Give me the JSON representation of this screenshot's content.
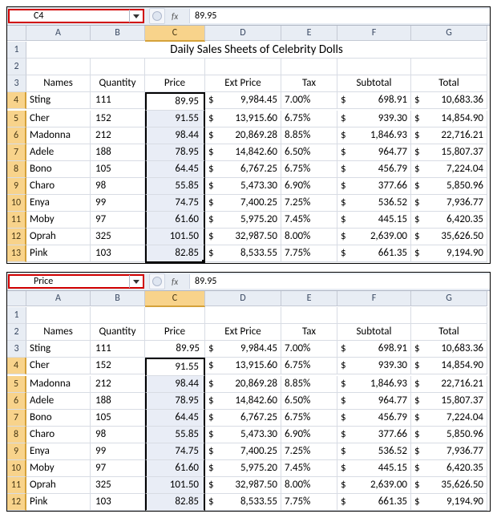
{
  "sheets": [
    {
      "nameBox": "C4",
      "formula": "89.95",
      "showTitle": true
    },
    {
      "nameBox": "Price",
      "formula": "89.95",
      "showTitle": false
    }
  ],
  "columns": [
    "A",
    "B",
    "C",
    "D",
    "E",
    "F",
    "G"
  ],
  "title": "Daily Sales Sheets of Celebrity Dolls",
  "headers": {
    "names": "Names",
    "quantity": "Quantity",
    "price": "Price",
    "extPrice": "Ext Price",
    "tax": "Tax",
    "subtotal": "Subtotal",
    "total": "Total"
  },
  "rows": [
    {
      "name": "Sting",
      "qty": "111",
      "price": "89.95",
      "ext": "9,984.45",
      "tax": "7.00%",
      "sub": "698.91",
      "total": "10,683.36"
    },
    {
      "name": "Cher",
      "qty": "152",
      "price": "91.55",
      "ext": "13,915.60",
      "tax": "6.75%",
      "sub": "939.30",
      "total": "14,854.90"
    },
    {
      "name": "Madonna",
      "qty": "212",
      "price": "98.44",
      "ext": "20,869.28",
      "tax": "8.85%",
      "sub": "1,846.93",
      "total": "22,716.21"
    },
    {
      "name": "Adele",
      "qty": "188",
      "price": "78.95",
      "ext": "14,842.60",
      "tax": "6.50%",
      "sub": "964.77",
      "total": "15,807.37"
    },
    {
      "name": "Bono",
      "qty": "105",
      "price": "64.45",
      "ext": "6,767.25",
      "tax": "6.75%",
      "sub": "456.79",
      "total": "7,224.04"
    },
    {
      "name": "Charo",
      "qty": "98",
      "price": "55.85",
      "ext": "5,473.30",
      "tax": "6.90%",
      "sub": "377.66",
      "total": "5,850.96"
    },
    {
      "name": "Enya",
      "qty": "99",
      "price": "74.75",
      "ext": "7,400.25",
      "tax": "7.25%",
      "sub": "536.52",
      "total": "7,936.77"
    },
    {
      "name": "Moby",
      "qty": "97",
      "price": "61.60",
      "ext": "5,975.20",
      "tax": "7.45%",
      "sub": "445.15",
      "total": "6,420.35"
    },
    {
      "name": "Oprah",
      "qty": "325",
      "price": "101.50",
      "ext": "32,987.50",
      "tax": "8.00%",
      "sub": "2,639.00",
      "total": "35,626.50"
    },
    {
      "name": "Pink",
      "qty": "103",
      "price": "82.85",
      "ext": "8,533.55",
      "tax": "7.75%",
      "sub": "661.35",
      "total": "9,194.90"
    }
  ],
  "fxLabel": "fx",
  "currency": "$",
  "selectedColumn": "C",
  "activeCellRow": 4,
  "selectionStartRow": 4,
  "selectionEndRow": 13
}
